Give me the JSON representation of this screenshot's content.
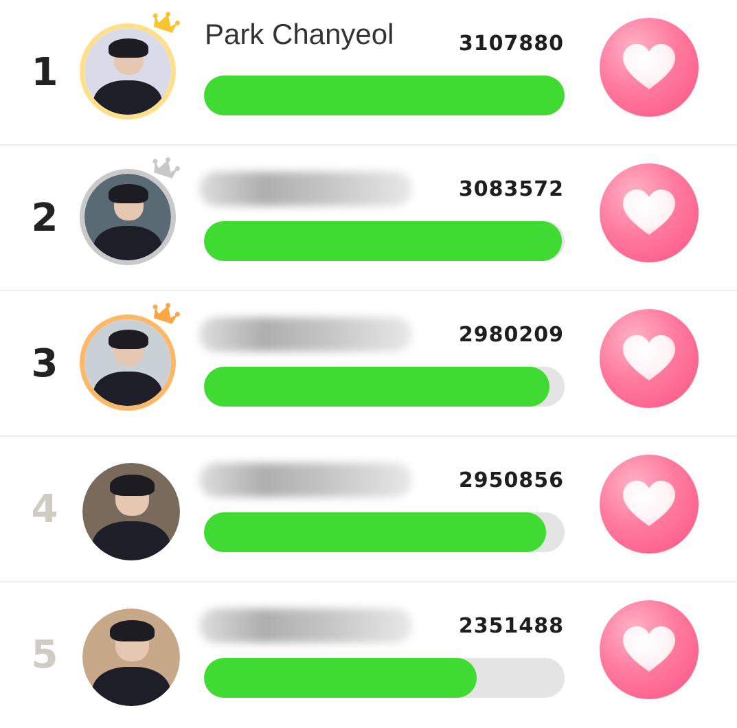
{
  "ranking": [
    {
      "rank": "1",
      "name": "Park Chanyeol",
      "name_blurred": false,
      "votes": "3107880",
      "progress": 1.0,
      "rank_color": "#222222",
      "border_color": "#ffe08a",
      "crown_color": "#f8c531",
      "avatar_bg": "#d9dbe8",
      "vote_icon": "heart-icon"
    },
    {
      "rank": "2",
      "name": "",
      "name_blurred": true,
      "votes": "3083572",
      "progress": 0.992,
      "rank_color": "#222222",
      "border_color": "#c9c9c9",
      "crown_color": "#c8c8c8",
      "avatar_bg": "#5a6a74",
      "vote_icon": "heart-icon"
    },
    {
      "rank": "3",
      "name": "",
      "name_blurred": true,
      "votes": "2980209",
      "progress": 0.959,
      "rank_color": "#222222",
      "border_color": "#ffb868",
      "crown_color": "#ffa646",
      "avatar_bg": "#c9d0d6",
      "vote_icon": "heart-icon"
    },
    {
      "rank": "4",
      "name": "",
      "name_blurred": true,
      "votes": "2950856",
      "progress": 0.949,
      "rank_color": "#cfcdc3",
      "border_color": "",
      "crown_color": "",
      "avatar_bg": "#7a6a5c",
      "vote_icon": "heart-icon"
    },
    {
      "rank": "5",
      "name": "",
      "name_blurred": true,
      "votes": "2351488",
      "progress": 0.757,
      "rank_color": "#cfcdc3",
      "border_color": "",
      "crown_color": "",
      "avatar_bg": "#c7a98a",
      "vote_icon": "heart-icon"
    }
  ],
  "colors": {
    "progress_fill": "#3fdb32",
    "progress_track": "#e4e4e4",
    "vote_button": "#fb6b92"
  }
}
